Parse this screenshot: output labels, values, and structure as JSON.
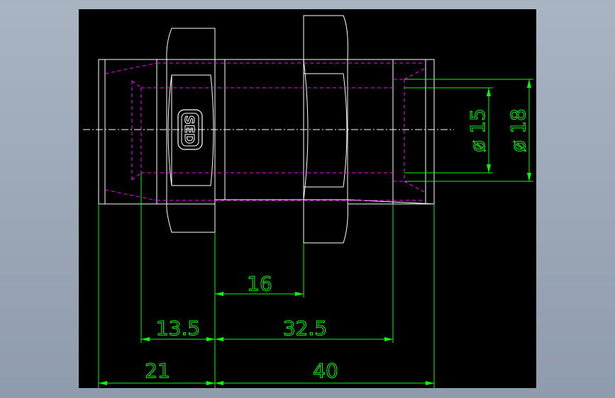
{
  "drawing": {
    "dimensions": {
      "len_16": "16",
      "len_13_5": "13.5",
      "len_32_5": "32.5",
      "len_21": "21",
      "len_40": "40",
      "dia_15": "ø 15",
      "dia_18": "ø 18"
    },
    "colors": {
      "background": "#000000",
      "outline": "#ffffff",
      "dimension": "#00ff00",
      "hidden": "#ff00ff"
    },
    "logo_text": "SED"
  }
}
